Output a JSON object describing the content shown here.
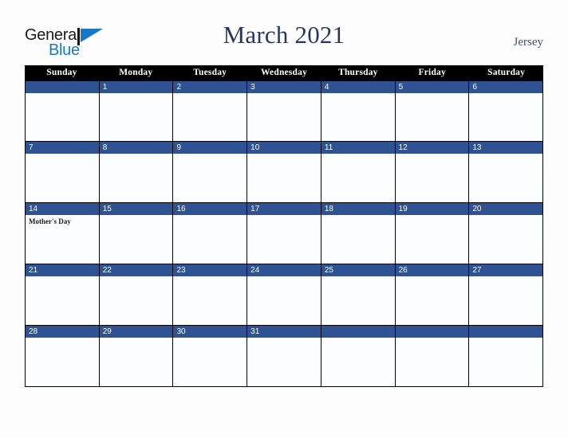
{
  "brand": {
    "word_one": "General",
    "word_two": "Blue",
    "mark": "triangle-logo-mark"
  },
  "header": {
    "title": "March 2021",
    "locale": "Jersey"
  },
  "colors": {
    "weekday_header_bg": "#000000",
    "weekday_header_text": "#ffffff",
    "date_band_bg": "#2f5293",
    "date_band_text": "#ffffff",
    "cell_bg": "#fcfdfe",
    "grid_line": "#000000",
    "title_text": "#27385f",
    "locale_text": "#3d5075",
    "brand_blue": "#1878c8",
    "page_bg": "#fdfdfd"
  },
  "calendar": {
    "weekdays": [
      "Sunday",
      "Monday",
      "Tuesday",
      "Wednesday",
      "Thursday",
      "Friday",
      "Saturday"
    ],
    "weeks": [
      [
        {
          "date": "",
          "events": []
        },
        {
          "date": "1",
          "events": []
        },
        {
          "date": "2",
          "events": []
        },
        {
          "date": "3",
          "events": []
        },
        {
          "date": "4",
          "events": []
        },
        {
          "date": "5",
          "events": []
        },
        {
          "date": "6",
          "events": []
        }
      ],
      [
        {
          "date": "7",
          "events": []
        },
        {
          "date": "8",
          "events": []
        },
        {
          "date": "9",
          "events": []
        },
        {
          "date": "10",
          "events": []
        },
        {
          "date": "11",
          "events": []
        },
        {
          "date": "12",
          "events": []
        },
        {
          "date": "13",
          "events": []
        }
      ],
      [
        {
          "date": "14",
          "events": [
            "Mother's Day"
          ]
        },
        {
          "date": "15",
          "events": []
        },
        {
          "date": "16",
          "events": []
        },
        {
          "date": "17",
          "events": []
        },
        {
          "date": "18",
          "events": []
        },
        {
          "date": "19",
          "events": []
        },
        {
          "date": "20",
          "events": []
        }
      ],
      [
        {
          "date": "21",
          "events": []
        },
        {
          "date": "22",
          "events": []
        },
        {
          "date": "23",
          "events": []
        },
        {
          "date": "24",
          "events": []
        },
        {
          "date": "25",
          "events": []
        },
        {
          "date": "26",
          "events": []
        },
        {
          "date": "27",
          "events": []
        }
      ],
      [
        {
          "date": "28",
          "events": []
        },
        {
          "date": "29",
          "events": []
        },
        {
          "date": "30",
          "events": []
        },
        {
          "date": "31",
          "events": []
        },
        {
          "date": "",
          "events": []
        },
        {
          "date": "",
          "events": []
        },
        {
          "date": "",
          "events": []
        }
      ]
    ]
  }
}
